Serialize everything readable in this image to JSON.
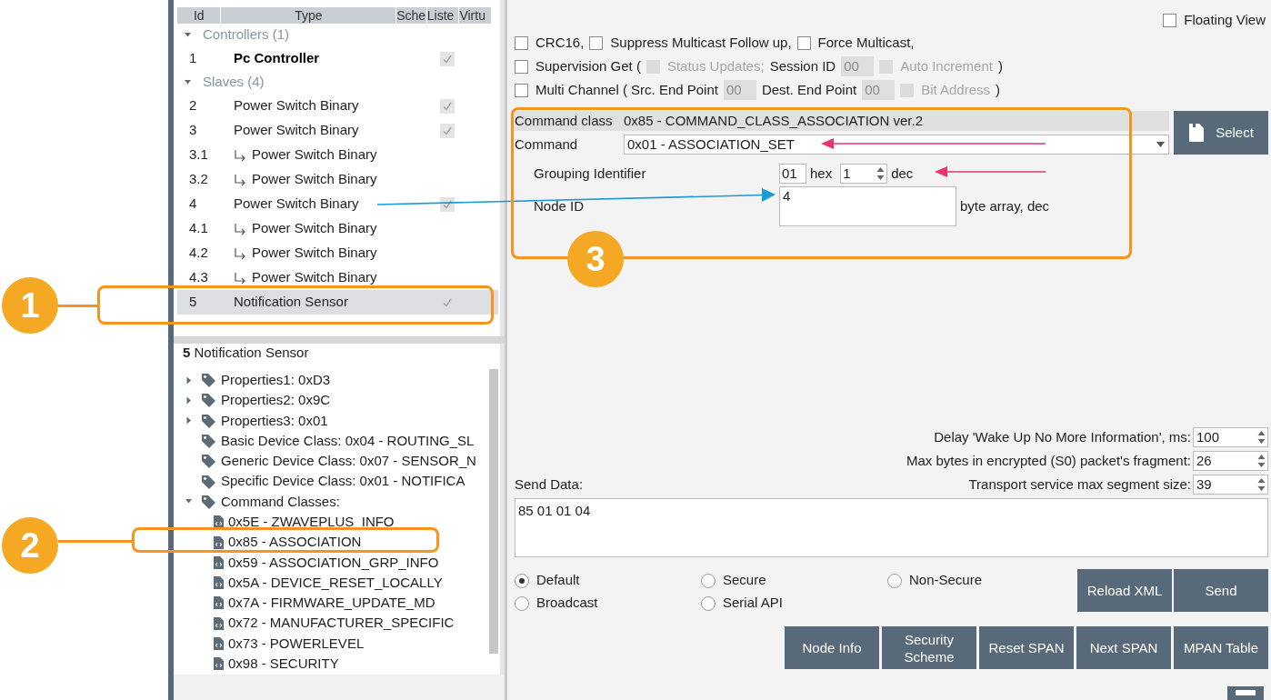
{
  "node_grid": {
    "columns": [
      "Id",
      "Type",
      "Sche",
      "Liste",
      "Virtu"
    ],
    "groups": [
      {
        "label": "Controllers (1)",
        "expanded": true,
        "nodes": [
          {
            "id": "1",
            "type": "Pc Controller",
            "kind": "controller",
            "listening": true,
            "selected": false
          }
        ]
      },
      {
        "label": "Slaves (4)",
        "expanded": true,
        "nodes": [
          {
            "id": "2",
            "type": "Power Switch Binary",
            "kind": "slave",
            "listening": true,
            "selected": false
          },
          {
            "id": "3",
            "type": "Power Switch Binary",
            "kind": "slave",
            "listening": true,
            "selected": false,
            "children": [
              {
                "id": "3.1",
                "type": "Power Switch Binary",
                "listening": false,
                "selected": false
              },
              {
                "id": "3.2",
                "type": "Power Switch Binary",
                "listening": false,
                "selected": false
              }
            ]
          },
          {
            "id": "4",
            "type": "Power Switch Binary",
            "kind": "slave",
            "listening": true,
            "selected": false,
            "children": [
              {
                "id": "4.1",
                "type": "Power Switch Binary",
                "listening": false,
                "selected": false
              },
              {
                "id": "4.2",
                "type": "Power Switch Binary",
                "listening": false,
                "selected": false
              },
              {
                "id": "4.3",
                "type": "Power Switch Binary",
                "listening": false,
                "selected": false
              }
            ]
          },
          {
            "id": "5",
            "type": "Notification Sensor",
            "kind": "slave",
            "listening": true,
            "selected": true
          }
        ]
      }
    ]
  },
  "node_info": {
    "title": "**5** Notification Sensor",
    "tree": [
      {
        "label": "Properties1: 0xD3",
        "kind": "property",
        "expanded": false
      },
      {
        "label": "Properties2: 0x9C",
        "kind": "property",
        "expanded": false
      },
      {
        "label": "Properties3: 0x01",
        "kind": "property",
        "expanded": false
      },
      {
        "label": "Basic Device Class: 0x04 - ROUTING_SL",
        "kind": "property"
      },
      {
        "label": "Generic Device Class: 0x07 - SENSOR_N",
        "kind": "property"
      },
      {
        "label": "Specific Device Class: 0x01 - NOTIFICA",
        "kind": "property"
      },
      {
        "label": "Command Classes:",
        "kind": "property",
        "expanded": true,
        "children": [
          {
            "label": "0x5E - ZWAVEPLUS_INFO",
            "kind": "command_class"
          },
          {
            "label": "0x85 - ASSOCIATION",
            "kind": "command_class"
          },
          {
            "label": "0x59 - ASSOCIATION_GRP_INFO",
            "kind": "command_class"
          },
          {
            "label": "0x5A - DEVICE_RESET_LOCALLY",
            "kind": "command_class"
          },
          {
            "label": "0x7A - FIRMWARE_UPDATE_MD",
            "kind": "command_class"
          },
          {
            "label": "0x72 - MANUFACTURER_SPECIFIC",
            "kind": "command_class"
          },
          {
            "label": "0x73 - POWERLEVEL",
            "kind": "command_class"
          },
          {
            "label": "0x98 - SECURITY",
            "kind": "command_class"
          }
        ]
      }
    ]
  },
  "floating_view": {
    "label": "Floating View",
    "checked": false
  },
  "options": [
    [
      {
        "kind": "checkbox",
        "label": "CRC16,",
        "checked": false,
        "disabled": false
      },
      {
        "kind": "checkbox",
        "label": "Suppress Multicast Follow up,",
        "checked": false,
        "disabled": false
      },
      {
        "kind": "checkbox",
        "label": "Force Multicast,",
        "checked": false,
        "disabled": false
      }
    ],
    [
      {
        "kind": "checkbox",
        "label": "Supervision Get (",
        "checked": false,
        "disabled": false
      },
      {
        "kind": "checkbox",
        "label": "Status Updates;",
        "checked": false,
        "disabled": true
      },
      {
        "kind": "text",
        "label": "Session ID"
      },
      {
        "kind": "field",
        "value": "00",
        "disabled": true
      },
      {
        "kind": "checkbox",
        "label": "Auto Increment",
        "checked": false,
        "disabled": true
      },
      {
        "kind": "text",
        "label": ")"
      }
    ],
    [
      {
        "kind": "checkbox",
        "label": "Multi Channel ( Src. End Point",
        "checked": false,
        "disabled": false
      },
      {
        "kind": "field",
        "value": "00",
        "disabled": true
      },
      {
        "kind": "text",
        "label": "Dest. End Point"
      },
      {
        "kind": "field",
        "value": "00",
        "disabled": true
      },
      {
        "kind": "checkbox",
        "label": "Bit Address",
        "checked": false,
        "disabled": true
      },
      {
        "kind": "text",
        "label": ")"
      }
    ]
  ],
  "command": {
    "class_label": "Command class",
    "class_value": "0x85 - COMMAND_CLASS_ASSOCIATION ver.2",
    "command_label": "Command",
    "command_value": "0x01 - ASSOCIATION_SET",
    "select_button": "Select"
  },
  "parameters": [
    {
      "kind": "number",
      "label": "Grouping Identifier",
      "hex": "01",
      "hex_unit": "hex",
      "value": "1",
      "unit": "dec"
    },
    {
      "kind": "array",
      "label": "Node ID",
      "value": "4",
      "unit": "byte array, dec"
    }
  ],
  "settings": [
    {
      "label": "Delay 'Wake Up No More Information', ms:",
      "value": "100"
    },
    {
      "label": "Max bytes in encrypted (S0) packet's fragment:",
      "value": "26"
    },
    {
      "label": "Transport service max segment size:",
      "value": "39"
    }
  ],
  "send_data": {
    "label": "Send Data:",
    "value": "85 01 01 04"
  },
  "security_modes": [
    {
      "label": "Default",
      "selected": true
    },
    {
      "label": "Secure",
      "selected": false
    },
    {
      "label": "Non-Secure",
      "selected": false
    },
    {
      "label": "Broadcast",
      "selected": false
    },
    {
      "label": "Serial API",
      "selected": false
    }
  ],
  "buttons_top": [
    "Reload XML",
    "Send"
  ],
  "buttons_bottom": [
    "Node Info",
    "Security Scheme",
    "Reset SPAN",
    "Next SPAN",
    "MPAN Table"
  ],
  "callouts": [
    {
      "number": "1"
    },
    {
      "number": "2"
    },
    {
      "number": "3"
    }
  ]
}
